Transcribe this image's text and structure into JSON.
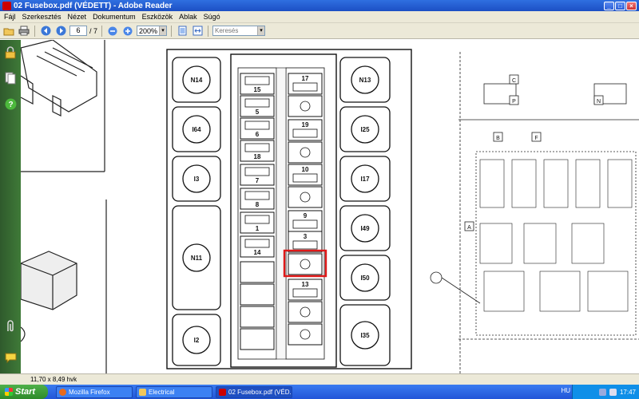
{
  "window": {
    "title": "02 Fusebox.pdf (VÉDETT) - Adobe Reader",
    "buttons": {
      "minimize": "_",
      "maximize": "□",
      "close": "×"
    }
  },
  "menu": {
    "items": [
      "Fájl",
      "Szerkesztés",
      "Nézet",
      "Dokumentum",
      "Eszközök",
      "Ablak",
      "Súgó"
    ]
  },
  "toolbar": {
    "page_current": "6",
    "page_total": "/ 7",
    "zoom": "200%",
    "search_placeholder": "Keresés"
  },
  "diagram": {
    "left_relays": [
      "N14",
      "I64",
      "I3",
      "N11",
      "I2"
    ],
    "right_relays": [
      "N13",
      "I25",
      "I17",
      "I49",
      "I50",
      "I35"
    ],
    "fuses_left": [
      "15",
      "5",
      "6",
      "18",
      "7",
      "8",
      "1",
      "14"
    ],
    "fuses_right": [
      "17",
      "19",
      "10",
      "9",
      "3",
      "13"
    ],
    "right_page_labels": [
      "C",
      "P",
      "N",
      "B",
      "F",
      "A"
    ],
    "highlight_color": "#e01818"
  },
  "status": {
    "page_size": "11,70 x 8,49 hvk"
  },
  "taskbar": {
    "start_label": "Start",
    "tasks": [
      "Mozilla Firefox",
      "Electrical",
      "02 Fusebox.pdf (VÉD..."
    ],
    "language": "HU",
    "clock": "17:47"
  }
}
